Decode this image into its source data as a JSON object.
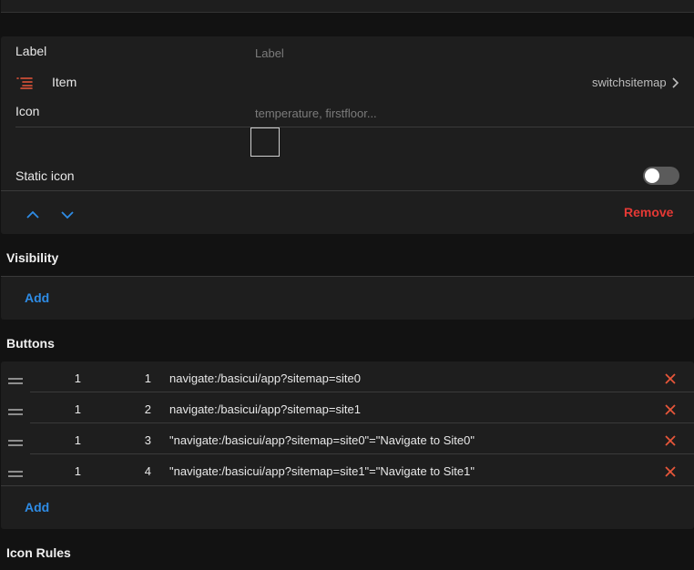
{
  "widget": {
    "label_field": {
      "label": "Label",
      "placeholder": "Label"
    },
    "item_field": {
      "label": "Item",
      "value": "switchsitemap"
    },
    "icon_field": {
      "label": "Icon",
      "placeholder": "temperature, firstfloor..."
    },
    "static_icon": {
      "label": "Static icon",
      "on": false
    },
    "remove_label": "Remove"
  },
  "visibility": {
    "title": "Visibility",
    "add_label": "Add"
  },
  "buttons": {
    "title": "Buttons",
    "add_label": "Add",
    "rows": [
      {
        "row": "1",
        "column": "1",
        "command": "navigate:/basicui/app?sitemap=site0"
      },
      {
        "row": "1",
        "column": "2",
        "command": "navigate:/basicui/app?sitemap=site1"
      },
      {
        "row": "1",
        "column": "3",
        "command": "\"navigate:/basicui/app?sitemap=site0\"=\"Navigate to Site0\""
      },
      {
        "row": "1",
        "column": "4",
        "command": "\"navigate:/basicui/app?sitemap=site1\"=\"Navigate to Site1\""
      }
    ]
  },
  "icon_rules": {
    "title": "Icon Rules"
  },
  "colors": {
    "accent": "#2e8ce6",
    "danger": "#e53935",
    "item_icon": "#e8563a"
  }
}
